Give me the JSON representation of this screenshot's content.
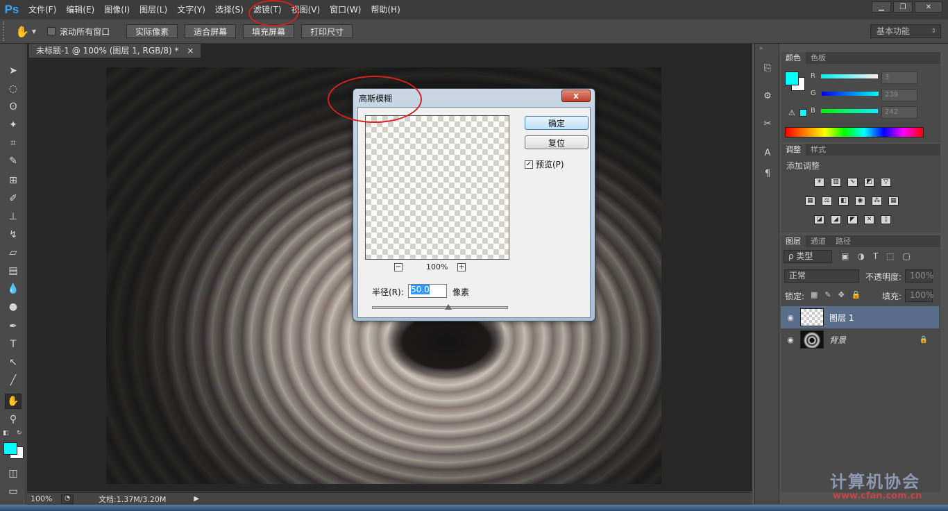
{
  "app": {
    "logo": "Ps"
  },
  "menu": [
    "文件(F)",
    "编辑(E)",
    "图像(I)",
    "图层(L)",
    "文字(Y)",
    "选择(S)",
    "滤镜(T)",
    "视图(V)",
    "窗口(W)",
    "帮助(H)"
  ],
  "options": {
    "scroll_all_label": "滚动所有窗口",
    "actual_pixels": "实际像素",
    "fit_screen": "适合屏幕",
    "fill_screen": "填充屏幕",
    "print_size": "打印尺寸",
    "workspace": "基本功能"
  },
  "document": {
    "tab_title": "未标题-1 @ 100% (图层 1, RGB/8) *",
    "close_glyph": "×"
  },
  "status": {
    "zoom": "100%",
    "doc_info": "文档:1.37M/3.20M"
  },
  "dialog": {
    "title": "高斯模糊",
    "close_glyph": "x",
    "ok_label": "确定",
    "reset_label": "复位",
    "preview_label": "预览(P)",
    "preview_checked": true,
    "preview_zoom": "100%",
    "zoom_out_glyph": "−",
    "zoom_in_glyph": "+",
    "radius_label": "半径(R):",
    "radius_value": "50.0",
    "radius_unit": "像素"
  },
  "color_panel": {
    "tabs": [
      "颜色",
      "色板"
    ],
    "foreground": "#00ffff",
    "background": "#ffffff",
    "channels": [
      {
        "label": "R",
        "value": "3"
      },
      {
        "label": "G",
        "value": "239"
      },
      {
        "label": "B",
        "value": "242"
      }
    ]
  },
  "adjust_panel": {
    "tabs": [
      "调整",
      "样式"
    ],
    "add_label": "添加调整"
  },
  "layers_panel": {
    "tabs": [
      "图层",
      "通道",
      "路径"
    ],
    "filter_kind": "ρ 类型",
    "blend_mode": "正常",
    "opacity_label": "不透明度:",
    "opacity_value": "100%",
    "lock_label": "锁定:",
    "fill_label": "填充:",
    "fill_value": "100%",
    "layers": [
      {
        "name": "图层 1",
        "selected": true
      },
      {
        "name": "背景",
        "selected": false,
        "locked": true
      }
    ]
  },
  "watermark": {
    "text": "计算机协会",
    "url": "www.cfan.com.cn"
  },
  "colors": {
    "accent": "#00ffff",
    "annotation": "#d6221c"
  }
}
